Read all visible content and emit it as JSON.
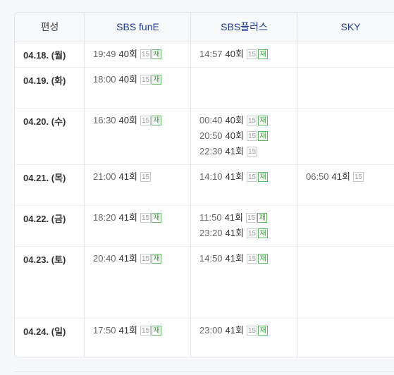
{
  "headers": [
    "편성",
    "SBS funE",
    "SBS플러스",
    "SKY"
  ],
  "rows": [
    {
      "date": "04.18. (월)",
      "cells": [
        [
          {
            "time": "19:49",
            "ep": "40회",
            "rating": "15",
            "rerun": "재"
          }
        ],
        [
          {
            "time": "14:57",
            "ep": "40회",
            "rating": "15",
            "rerun": "재"
          }
        ],
        []
      ]
    },
    {
      "date": "04.19. (화)",
      "cells": [
        [
          {
            "time": "18:00",
            "ep": "40회",
            "rating": "15",
            "rerun": "재"
          }
        ],
        [],
        []
      ]
    },
    {
      "date": "04.20. (수)",
      "cells": [
        [
          {
            "time": "16:30",
            "ep": "40회",
            "rating": "15",
            "rerun": "재"
          }
        ],
        [
          {
            "time": "00:40",
            "ep": "40회",
            "rating": "15",
            "rerun": "재"
          },
          {
            "time": "20:50",
            "ep": "40회",
            "rating": "15",
            "rerun": "재"
          },
          {
            "time": "22:30",
            "ep": "41회",
            "rating": "15",
            "rerun": ""
          }
        ],
        []
      ]
    },
    {
      "date": "04.21. (목)",
      "cells": [
        [
          {
            "time": "21:00",
            "ep": "41회",
            "rating": "15",
            "rerun": ""
          }
        ],
        [
          {
            "time": "14:10",
            "ep": "41회",
            "rating": "15",
            "rerun": "재"
          }
        ],
        [
          {
            "time": "06:50",
            "ep": "41회",
            "rating": "15",
            "rerun": ""
          }
        ]
      ]
    },
    {
      "date": "04.22. (금)",
      "cells": [
        [
          {
            "time": "18:20",
            "ep": "41회",
            "rating": "15",
            "rerun": "재"
          }
        ],
        [
          {
            "time": "11:50",
            "ep": "41회",
            "rating": "15",
            "rerun": "재"
          },
          {
            "time": "23:20",
            "ep": "41회",
            "rating": "15",
            "rerun": "재"
          }
        ],
        []
      ]
    },
    {
      "date": "04.23. (토)",
      "cells": [
        [
          {
            "time": "20:40",
            "ep": "41회",
            "rating": "15",
            "rerun": "재"
          }
        ],
        [
          {
            "time": "14:50",
            "ep": "41회",
            "rating": "15",
            "rerun": "재"
          }
        ],
        []
      ]
    },
    {
      "date": "04.24. (일)",
      "cells": [
        [
          {
            "time": "17:50",
            "ep": "41회",
            "rating": "15",
            "rerun": "재"
          }
        ],
        [
          {
            "time": "23:00",
            "ep": "41회",
            "rating": "15",
            "rerun": "재"
          }
        ],
        []
      ]
    }
  ]
}
